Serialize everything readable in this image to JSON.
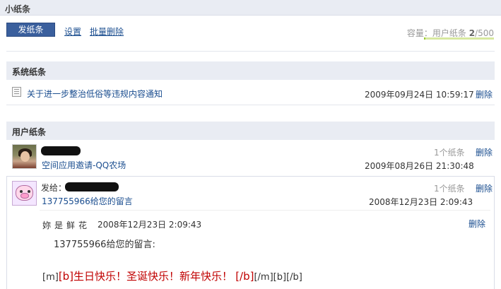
{
  "page": {
    "title": "小纸条"
  },
  "toolbar": {
    "new_note": "发纸条",
    "settings": "设置",
    "batch_delete": "批量删除"
  },
  "capacity": {
    "label": "容量：用户纸条",
    "used": "2",
    "total": "/500",
    "used_fraction": 0.004
  },
  "system_section": {
    "title": "系统纸条",
    "items": [
      {
        "title": "关于进一步整治低俗等违规内容通知",
        "date": "2009年09月24日",
        "time": "10:59:17",
        "delete": "删除",
        "icon": "document-icon"
      }
    ]
  },
  "user_section": {
    "title": "用户纸条",
    "items": [
      {
        "subject": "空间应用邀请-QQ农场",
        "count": "1个纸条",
        "date": "2009年08月26日",
        "time": "21:30:48",
        "delete": "删除",
        "avatar": "girl-photo-avatar"
      },
      {
        "prefix": "发给：",
        "subject": "137755966给您的留言",
        "count": "1个纸条",
        "date": "2008年12月23日",
        "time": "2:09:43",
        "delete": "删除",
        "avatar": "pig-avatar"
      }
    ]
  },
  "message": {
    "sender": "妳是鲜花",
    "date": "2008年12月23日",
    "time": "2:09:43",
    "delete": "删除",
    "body": "137755966给您的留言:",
    "bb_pre": "[m]",
    "bb_open": "[b]",
    "greeting": "生日快乐！圣诞快乐！新年快乐！",
    "bb_close": "[/b]",
    "bb_post": "[/m][b][/b]"
  }
}
